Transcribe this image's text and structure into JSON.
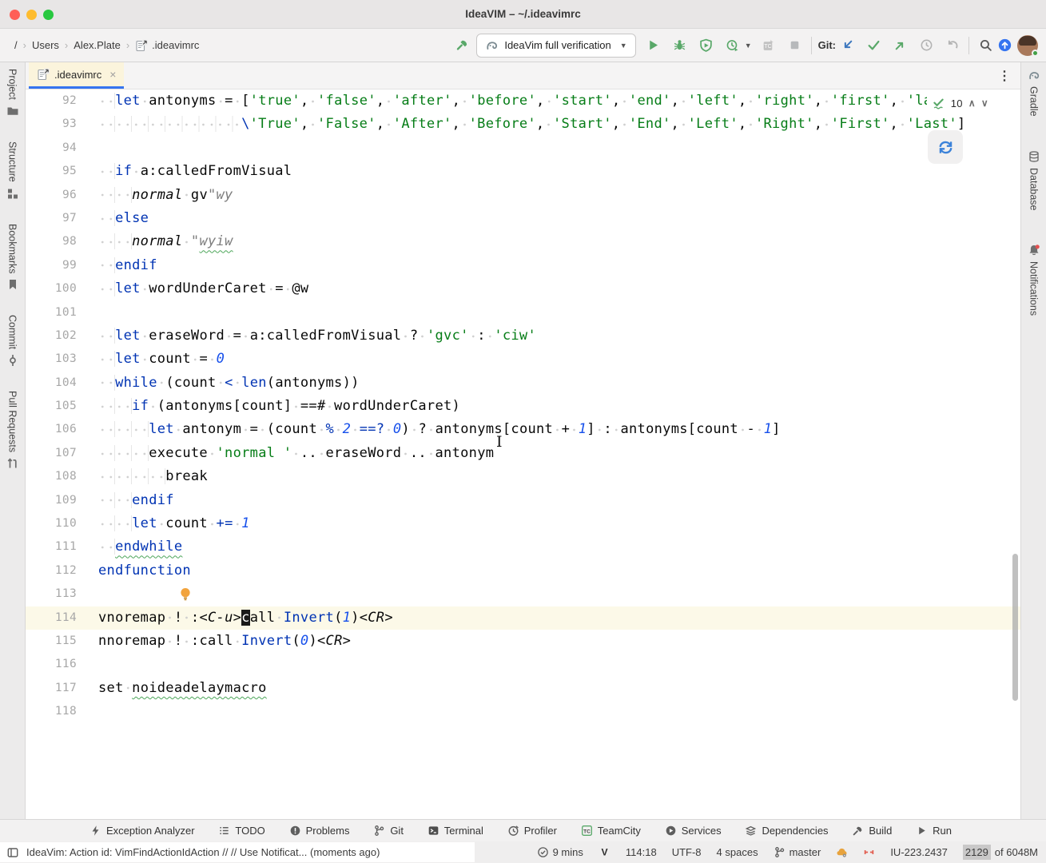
{
  "window": {
    "title": "IdeaVIM – ~/.ideavimrc"
  },
  "toolbar": {
    "breadcrumbs": [
      "/",
      "Users",
      "Alex.Plate",
      ".ideavimrc"
    ],
    "run_config": "IdeaVim full verification",
    "git_label": "Git:"
  },
  "tabbar": {
    "tab_label": ".ideavimrc",
    "close_glyph": "×",
    "kebab_glyph": "⋮"
  },
  "left_stripe": [
    {
      "label": "Project",
      "icon": "folder-icon"
    },
    {
      "label": "Structure",
      "icon": "structure-icon"
    },
    {
      "label": "Bookmarks",
      "icon": "bookmark-icon"
    },
    {
      "label": "Commit",
      "icon": "commit-icon"
    },
    {
      "label": "Pull Requests",
      "icon": "pull-request-icon"
    }
  ],
  "right_stripe": [
    {
      "label": "Gradle",
      "icon": "gradle-icon"
    },
    {
      "label": "Database",
      "icon": "database-icon"
    },
    {
      "label": "Notifications",
      "icon": "notifications-icon"
    }
  ],
  "inspection_widget": {
    "count": "10",
    "up_glyph": "∧",
    "down_glyph": "∨"
  },
  "editor": {
    "lines": [
      {
        "n": "92",
        "ind": 2,
        "parts": [
          [
            "k",
            "let"
          ],
          [
            "sp",
            " "
          ],
          [
            "p",
            "antonyms"
          ],
          [
            "sp",
            " "
          ],
          [
            "p",
            "="
          ],
          [
            "sp",
            " "
          ],
          [
            "p",
            "["
          ],
          [
            "s",
            "'true'"
          ],
          [
            "p",
            ","
          ],
          [
            "sp",
            " "
          ],
          [
            "s",
            "'false'"
          ],
          [
            "p",
            ","
          ],
          [
            "sp",
            " "
          ],
          [
            "s",
            "'after'"
          ],
          [
            "p",
            ","
          ],
          [
            "sp",
            " "
          ],
          [
            "s",
            "'before'"
          ],
          [
            "p",
            ","
          ],
          [
            "sp",
            " "
          ],
          [
            "s",
            "'start'"
          ],
          [
            "p",
            ","
          ],
          [
            "sp",
            " "
          ],
          [
            "s",
            "'end'"
          ],
          [
            "p",
            ","
          ],
          [
            "sp",
            " "
          ],
          [
            "s",
            "'left'"
          ],
          [
            "p",
            ","
          ],
          [
            "sp",
            " "
          ],
          [
            "s",
            "'right'"
          ],
          [
            "p",
            ","
          ],
          [
            "sp",
            " "
          ],
          [
            "s",
            "'first'"
          ],
          [
            "p",
            ","
          ],
          [
            "sp",
            " "
          ],
          [
            "s",
            "'last'"
          ],
          [
            "p",
            ","
          ]
        ]
      },
      {
        "n": "93",
        "ind": 17,
        "parts": [
          [
            "k",
            "\\"
          ],
          [
            "s",
            "'True'"
          ],
          [
            "p",
            ","
          ],
          [
            "sp",
            " "
          ],
          [
            "s",
            "'False'"
          ],
          [
            "p",
            ","
          ],
          [
            "sp",
            " "
          ],
          [
            "s",
            "'After'"
          ],
          [
            "p",
            ","
          ],
          [
            "sp",
            " "
          ],
          [
            "s",
            "'Before'"
          ],
          [
            "p",
            ","
          ],
          [
            "sp",
            " "
          ],
          [
            "s",
            "'Start'"
          ],
          [
            "p",
            ","
          ],
          [
            "sp",
            " "
          ],
          [
            "s",
            "'End'"
          ],
          [
            "p",
            ","
          ],
          [
            "sp",
            " "
          ],
          [
            "s",
            "'Left'"
          ],
          [
            "p",
            ","
          ],
          [
            "sp",
            " "
          ],
          [
            "s",
            "'Right'"
          ],
          [
            "p",
            ","
          ],
          [
            "sp",
            " "
          ],
          [
            "s",
            "'First'"
          ],
          [
            "p",
            ","
          ],
          [
            "sp",
            " "
          ],
          [
            "s",
            "'Last'"
          ],
          [
            "p",
            "]"
          ]
        ]
      },
      {
        "n": "94",
        "ind": 0,
        "parts": []
      },
      {
        "n": "95",
        "ind": 2,
        "parts": [
          [
            "k",
            "if"
          ],
          [
            "sp",
            " "
          ],
          [
            "p",
            "a:calledFromVisual"
          ]
        ]
      },
      {
        "n": "96",
        "ind": 4,
        "parts": [
          [
            "i",
            "normal"
          ],
          [
            "sp",
            " "
          ],
          [
            "p",
            "gv"
          ],
          [
            "g",
            "\"wy"
          ]
        ]
      },
      {
        "n": "97",
        "ind": 2,
        "parts": [
          [
            "k",
            "else"
          ]
        ]
      },
      {
        "n": "98",
        "ind": 4,
        "parts": [
          [
            "i",
            "normal"
          ],
          [
            "sp",
            " "
          ],
          [
            "g",
            "\""
          ],
          [
            "gw",
            "wyiw"
          ]
        ]
      },
      {
        "n": "99",
        "ind": 2,
        "parts": [
          [
            "k",
            "endif"
          ]
        ]
      },
      {
        "n": "100",
        "ind": 2,
        "parts": [
          [
            "k",
            "let"
          ],
          [
            "sp",
            " "
          ],
          [
            "p",
            "wordUnderCaret"
          ],
          [
            "sp",
            " "
          ],
          [
            "p",
            "="
          ],
          [
            "sp",
            " "
          ],
          [
            "p",
            "@w"
          ]
        ]
      },
      {
        "n": "101",
        "ind": 0,
        "parts": []
      },
      {
        "n": "102",
        "ind": 2,
        "parts": [
          [
            "k",
            "let"
          ],
          [
            "sp",
            " "
          ],
          [
            "p",
            "eraseWord"
          ],
          [
            "sp",
            " "
          ],
          [
            "p",
            "="
          ],
          [
            "sp",
            " "
          ],
          [
            "p",
            "a:calledFromVisual"
          ],
          [
            "sp",
            " "
          ],
          [
            "p",
            "?"
          ],
          [
            "sp",
            " "
          ],
          [
            "s",
            "'gvc'"
          ],
          [
            "sp",
            " "
          ],
          [
            "p",
            ":"
          ],
          [
            "sp",
            " "
          ],
          [
            "s",
            "'ciw'"
          ]
        ]
      },
      {
        "n": "103",
        "ind": 2,
        "parts": [
          [
            "k",
            "let"
          ],
          [
            "sp",
            " "
          ],
          [
            "p",
            "count"
          ],
          [
            "sp",
            " "
          ],
          [
            "p",
            "="
          ],
          [
            "sp",
            " "
          ],
          [
            "n",
            "0"
          ]
        ]
      },
      {
        "n": "104",
        "ind": 2,
        "parts": [
          [
            "k",
            "while"
          ],
          [
            "sp",
            " "
          ],
          [
            "p",
            "(count"
          ],
          [
            "sp",
            " "
          ],
          [
            "op",
            "<"
          ],
          [
            "sp",
            " "
          ],
          [
            "f",
            "len"
          ],
          [
            "p",
            "(antonyms))"
          ]
        ]
      },
      {
        "n": "105",
        "ind": 4,
        "parts": [
          [
            "k",
            "if"
          ],
          [
            "sp",
            " "
          ],
          [
            "p",
            "(antonyms[count]"
          ],
          [
            "sp",
            " "
          ],
          [
            "p",
            "==#"
          ],
          [
            "sp",
            " "
          ],
          [
            "p",
            "wordUnderCaret)"
          ]
        ]
      },
      {
        "n": "106",
        "ind": 6,
        "parts": [
          [
            "k",
            "let"
          ],
          [
            "sp",
            " "
          ],
          [
            "p",
            "antonym"
          ],
          [
            "sp",
            " "
          ],
          [
            "p",
            "="
          ],
          [
            "sp",
            " "
          ],
          [
            "p",
            "(count"
          ],
          [
            "sp",
            " "
          ],
          [
            "op",
            "%"
          ],
          [
            "sp",
            " "
          ],
          [
            "n",
            "2"
          ],
          [
            "sp",
            " "
          ],
          [
            "op",
            "==?"
          ],
          [
            "sp",
            " "
          ],
          [
            "n",
            "0"
          ],
          [
            "p",
            ")"
          ],
          [
            "sp",
            " "
          ],
          [
            "p",
            "?"
          ],
          [
            "sp",
            " "
          ],
          [
            "p",
            "antonyms[count"
          ],
          [
            "sp",
            " "
          ],
          [
            "p",
            "+"
          ],
          [
            "sp",
            " "
          ],
          [
            "n",
            "1"
          ],
          [
            "p",
            "]"
          ],
          [
            "sp",
            " "
          ],
          [
            "p",
            ":"
          ],
          [
            "sp",
            " "
          ],
          [
            "p",
            "antonyms[count"
          ],
          [
            "sp",
            " "
          ],
          [
            "p",
            "-"
          ],
          [
            "sp",
            " "
          ],
          [
            "n",
            "1"
          ],
          [
            "p",
            "]"
          ]
        ]
      },
      {
        "n": "107",
        "ind": 6,
        "parts": [
          [
            "p",
            "execute"
          ],
          [
            "sp",
            " "
          ],
          [
            "s",
            "'normal '"
          ],
          [
            "sp",
            " "
          ],
          [
            "p",
            ".."
          ],
          [
            "sp",
            " "
          ],
          [
            "p",
            "eraseWord"
          ],
          [
            "sp",
            " "
          ],
          [
            "p",
            ".."
          ],
          [
            "sp",
            " "
          ],
          [
            "p",
            "antonym"
          ]
        ]
      },
      {
        "n": "108",
        "ind": 8,
        "parts": [
          [
            "p",
            "break"
          ]
        ]
      },
      {
        "n": "109",
        "ind": 4,
        "parts": [
          [
            "k",
            "endif"
          ]
        ]
      },
      {
        "n": "110",
        "ind": 4,
        "parts": [
          [
            "k",
            "let"
          ],
          [
            "sp",
            " "
          ],
          [
            "p",
            "count"
          ],
          [
            "sp",
            " "
          ],
          [
            "op",
            "+="
          ],
          [
            "sp",
            " "
          ],
          [
            "n",
            "1"
          ]
        ]
      },
      {
        "n": "111",
        "ind": 2,
        "parts": [
          [
            "kw",
            "endwhile"
          ]
        ]
      },
      {
        "n": "112",
        "ind": 0,
        "parts": [
          [
            "k",
            "endfunction"
          ]
        ]
      },
      {
        "n": "113",
        "ind": 0,
        "bulb": true,
        "parts": []
      },
      {
        "n": "114",
        "ind": 0,
        "cur": true,
        "parts": [
          [
            "p",
            "vnoremap"
          ],
          [
            "sp",
            " "
          ],
          [
            "p",
            "!"
          ],
          [
            "sp",
            " "
          ],
          [
            "p",
            ":"
          ],
          [
            "i",
            "<C-u>"
          ],
          [
            "c",
            "c"
          ],
          [
            "p",
            "all"
          ],
          [
            "sp",
            " "
          ],
          [
            "f",
            "Invert"
          ],
          [
            "p",
            "("
          ],
          [
            "n",
            "1"
          ],
          [
            "p",
            ")"
          ],
          [
            "i",
            "<CR>"
          ]
        ]
      },
      {
        "n": "115",
        "ind": 0,
        "parts": [
          [
            "p",
            "nnoremap"
          ],
          [
            "sp",
            " "
          ],
          [
            "p",
            "!"
          ],
          [
            "sp",
            " "
          ],
          [
            "p",
            ":call"
          ],
          [
            "sp",
            " "
          ],
          [
            "f",
            "Invert"
          ],
          [
            "p",
            "("
          ],
          [
            "n",
            "0"
          ],
          [
            "p",
            ")"
          ],
          [
            "i",
            "<CR>"
          ]
        ]
      },
      {
        "n": "116",
        "ind": 0,
        "parts": []
      },
      {
        "n": "117",
        "ind": 0,
        "parts": [
          [
            "p",
            "set"
          ],
          [
            "sp",
            " "
          ],
          [
            "w",
            "noideadelaymacro"
          ]
        ]
      },
      {
        "n": "118",
        "ind": 0,
        "parts": []
      }
    ]
  },
  "bottom_toolbar": [
    {
      "label": "Exception Analyzer",
      "icon": "lightning-icon"
    },
    {
      "label": "TODO",
      "icon": "todo-list-icon"
    },
    {
      "label": "Problems",
      "icon": "problems-icon"
    },
    {
      "label": "Git",
      "icon": "git-branch-icon"
    },
    {
      "label": "Terminal",
      "icon": "terminal-icon"
    },
    {
      "label": "Profiler",
      "icon": "profiler-icon"
    },
    {
      "label": "TeamCity",
      "icon": "teamcity-icon"
    },
    {
      "label": "Services",
      "icon": "services-icon"
    },
    {
      "label": "Dependencies",
      "icon": "dependencies-icon"
    },
    {
      "label": "Build",
      "icon": "build-hammer-icon"
    },
    {
      "label": "Run",
      "icon": "run-play-icon"
    }
  ],
  "status_bar": {
    "message": "IdeaVim: Action id: VimFindActionIdAction // // Use Notificat... (moments ago)",
    "items": [
      {
        "label": "9 mins",
        "icon": "clock-check-icon"
      },
      {
        "label": "",
        "icon": "ideavim-icon"
      },
      {
        "label": "114:18",
        "icon": ""
      },
      {
        "label": "UTF-8",
        "icon": ""
      },
      {
        "label": "4 spaces",
        "icon": ""
      },
      {
        "label": "master",
        "icon": "git-branch-icon"
      },
      {
        "label": "",
        "icon": "cloud-sync-icon"
      },
      {
        "label": "",
        "icon": "no-wrap-icon"
      },
      {
        "label": "IU-223.2437",
        "icon": ""
      }
    ],
    "memory": {
      "used": "2129",
      "suffix": " of 6048M"
    }
  },
  "colors": {
    "accent_blue": "#3574F0",
    "run_green": "#59A869",
    "keyword": "#0033B3",
    "string": "#067D17",
    "number": "#1750EB",
    "current_line": "#FCF9E8",
    "tab_bg": "#FBF4DC"
  }
}
